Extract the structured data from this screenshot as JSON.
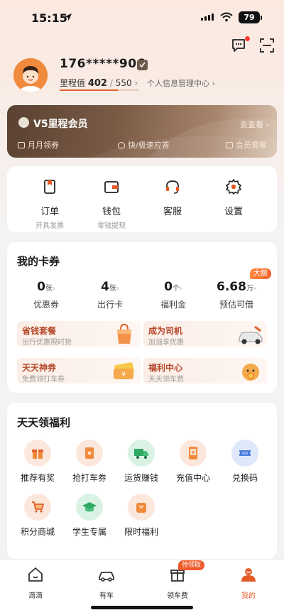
{
  "status_bar": {
    "time": "15:15",
    "battery": "79"
  },
  "profile": {
    "phone": "176*****906",
    "mileage_label": "里程值",
    "mileage_current": "402",
    "mileage_total": "550",
    "mileage_progress": 0.73,
    "info_link": "个人信息管理中心"
  },
  "vip_card": {
    "title": "V5里程会员",
    "link": "去查看",
    "perks": [
      "月月领券",
      "快/极速应答",
      "会员套餐"
    ]
  },
  "functions": [
    {
      "label": "订单",
      "sub": "开具发票",
      "icon": "order-icon"
    },
    {
      "label": "钱包",
      "sub": "零钱提现",
      "icon": "wallet-icon"
    },
    {
      "label": "客服",
      "sub": "",
      "icon": "headset-icon"
    },
    {
      "label": "设置",
      "sub": "",
      "icon": "gear-icon"
    }
  ],
  "coupons": {
    "title": "我的卡券",
    "badge": "大额",
    "stats": [
      {
        "value": "0",
        "unit": "张",
        "label": "优惠券"
      },
      {
        "value": "4",
        "unit": "张",
        "label": "出行卡"
      },
      {
        "value": "0",
        "unit": "个",
        "label": "福利金"
      },
      {
        "value": "6.68",
        "unit": "万",
        "label": "预估可借"
      }
    ],
    "promos": [
      {
        "title": "省钱套餐",
        "sub": "出行优惠限时抢"
      },
      {
        "title": "成为司机",
        "sub": "加油享优惠"
      },
      {
        "title": "天天神券",
        "sub": "免费领打车券"
      },
      {
        "title": "福利中心",
        "sub": "天天领车费"
      }
    ]
  },
  "welfare": {
    "title": "天天领福利",
    "items": [
      {
        "label": "推荐有奖",
        "icon": "gift-box-icon"
      },
      {
        "label": "抢打车券",
        "icon": "coupon-icon"
      },
      {
        "label": "运货赚钱",
        "icon": "truck-icon"
      },
      {
        "label": "充值中心",
        "icon": "recharge-icon"
      },
      {
        "label": "兑换码",
        "icon": "ticket-icon"
      },
      {
        "label": "积分商城",
        "icon": "cart-icon"
      },
      {
        "label": "学生专属",
        "icon": "graduation-cap-icon"
      },
      {
        "label": "限时福利",
        "icon": "bag-icon"
      }
    ]
  },
  "tabbar": {
    "badge": "待领取",
    "tabs": [
      {
        "label": "滴滴"
      },
      {
        "label": "有车"
      },
      {
        "label": "领车费"
      },
      {
        "label": "我的"
      }
    ]
  },
  "colors": {
    "accent": "#e45a24",
    "vip_brown": "#6b4c3a"
  }
}
